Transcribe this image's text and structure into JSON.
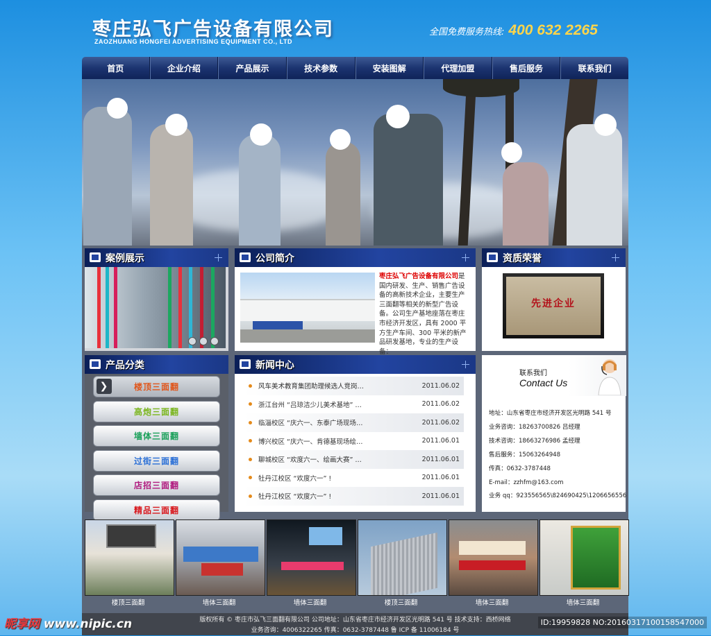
{
  "header": {
    "company_cn": "枣庄弘飞广告设备有限公司",
    "company_en": "ZAOZHUANG HONGFEI ADVERTISING EQUIPMENT CO., LTD",
    "hotline_label": "全国免费服务热线:",
    "hotline_number": "400 632 2265"
  },
  "nav": [
    "首页",
    "企业介绍",
    "产品展示",
    "技术参数",
    "安装图解",
    "代理加盟",
    "售后服务",
    "联系我们"
  ],
  "panels": {
    "case_title": "案例展示",
    "intro_title": "公司简介",
    "honor_title": "资质荣誉",
    "product_title": "产品分类",
    "news_title": "新闻中心"
  },
  "intro": {
    "company": "枣庄弘飞广告设备有限公司",
    "text": "是国内研发、生产、销售广告设备的高新技术企业，主要生产三面翻等相关的新型广告设备。公司生产基地座落在枣庄市经济开发区，具有 2000 平方生产车间、300 平米的新产品研发基地，专业的生产设备："
  },
  "honor": {
    "cert_title": "先进企业"
  },
  "products": [
    {
      "label": "楼顶三面翻",
      "color": "#e0561b"
    },
    {
      "label": "高炮三面翻",
      "color": "#7ab51d"
    },
    {
      "label": "墙体三面翻",
      "color": "#1aa05a"
    },
    {
      "label": "过街三面翻",
      "color": "#2a6fd6"
    },
    {
      "label": "店招三面翻",
      "color": "#b0197e"
    },
    {
      "label": "精品三面翻",
      "color": "#d8161b"
    }
  ],
  "news": [
    {
      "title": "风车美术教育集团助理候选人竞岗…",
      "date": "2011.06.02"
    },
    {
      "title": "浙江台州 “吕琼洁少儿美术基地” …",
      "date": "2011.06.02"
    },
    {
      "title": "临淄校区 “庆六一、东泰广场现场…",
      "date": "2011.06.02"
    },
    {
      "title": "博兴校区 “庆六一、肯德基现场绘…",
      "date": "2011.06.01"
    },
    {
      "title": "聊城校区 “欢度六一、绘画大赛” …",
      "date": "2011.06.01"
    },
    {
      "title": "牡丹江校区 “欢度六一” !",
      "date": "2011.06.01"
    },
    {
      "title": "牡丹江校区 “欢度六一” !",
      "date": "2011.06.01"
    }
  ],
  "contact": {
    "banner_cn": "联系我们",
    "banner_en": "Contact Us",
    "lines": [
      "地址：山东省枣庄市经济开发区光明路 541 号",
      "业务咨询：18263700826 吕经理",
      "技术咨询：18663276986 孟经理",
      "售后服务：15063264948",
      "传真：0632-3787448",
      "E-mail：zzhfm@163.com",
      "业务 qq：923556565\\824690425\\1206656556"
    ]
  },
  "thumbs": [
    "楼顶三面翻",
    "墙体三面翻",
    "墙体三面翻",
    "楼顶三面翻",
    "墙体三面翻",
    "墙体三面翻"
  ],
  "footer": {
    "line1": "版权所有 © 枣庄市弘飞三面翻有限公司  公司地址：山东省枣庄市经济开发区光明路 541 号  技术支持：西桥网络",
    "line2": "业务咨询：4006322265  传真：0632-3787448  鲁 ICP 备 11006184 号"
  },
  "watermark": {
    "logo_cn": "昵享网",
    "logo_url": "www.nipic.cn",
    "id": "ID:19959828 NO:20160317100158547000"
  },
  "colors": {
    "nav_bg": "#1c3470",
    "hotline": "#ffd54a",
    "panel_head": "#2244a0",
    "intro_company": "#dd0000",
    "bullet": "#e48a1b"
  },
  "icons": [
    "film-icon",
    "plus-icon",
    "arrow-right-icon",
    "agent-headset-icon"
  ]
}
